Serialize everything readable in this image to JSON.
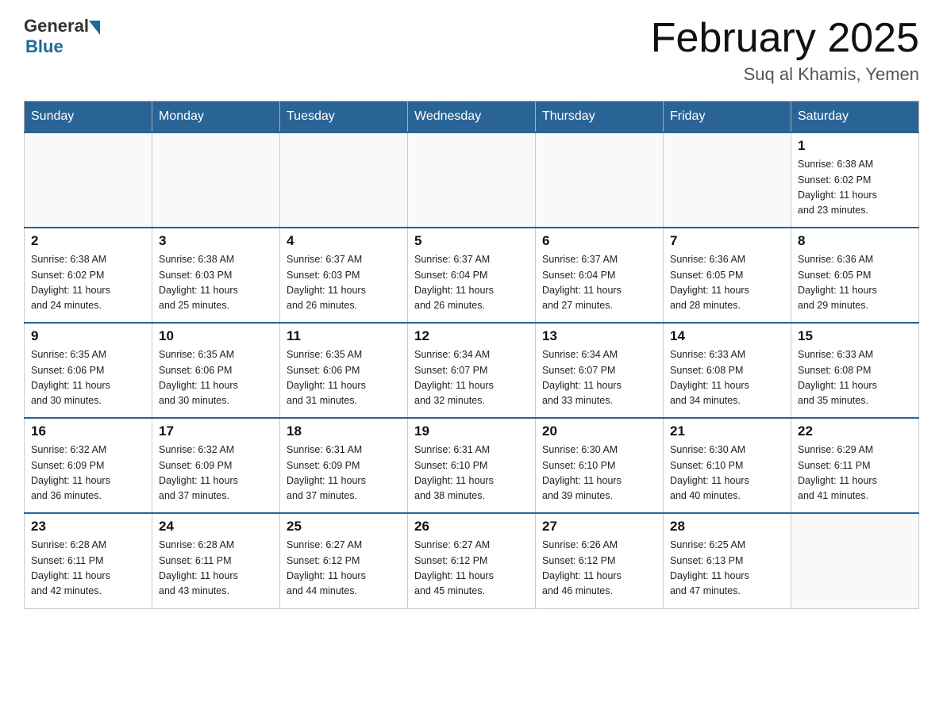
{
  "header": {
    "logo_general": "General",
    "logo_blue": "Blue",
    "month_title": "February 2025",
    "location": "Suq al Khamis, Yemen"
  },
  "days_of_week": [
    "Sunday",
    "Monday",
    "Tuesday",
    "Wednesday",
    "Thursday",
    "Friday",
    "Saturday"
  ],
  "weeks": [
    [
      {
        "day": "",
        "info": ""
      },
      {
        "day": "",
        "info": ""
      },
      {
        "day": "",
        "info": ""
      },
      {
        "day": "",
        "info": ""
      },
      {
        "day": "",
        "info": ""
      },
      {
        "day": "",
        "info": ""
      },
      {
        "day": "1",
        "info": "Sunrise: 6:38 AM\nSunset: 6:02 PM\nDaylight: 11 hours\nand 23 minutes."
      }
    ],
    [
      {
        "day": "2",
        "info": "Sunrise: 6:38 AM\nSunset: 6:02 PM\nDaylight: 11 hours\nand 24 minutes."
      },
      {
        "day": "3",
        "info": "Sunrise: 6:38 AM\nSunset: 6:03 PM\nDaylight: 11 hours\nand 25 minutes."
      },
      {
        "day": "4",
        "info": "Sunrise: 6:37 AM\nSunset: 6:03 PM\nDaylight: 11 hours\nand 26 minutes."
      },
      {
        "day": "5",
        "info": "Sunrise: 6:37 AM\nSunset: 6:04 PM\nDaylight: 11 hours\nand 26 minutes."
      },
      {
        "day": "6",
        "info": "Sunrise: 6:37 AM\nSunset: 6:04 PM\nDaylight: 11 hours\nand 27 minutes."
      },
      {
        "day": "7",
        "info": "Sunrise: 6:36 AM\nSunset: 6:05 PM\nDaylight: 11 hours\nand 28 minutes."
      },
      {
        "day": "8",
        "info": "Sunrise: 6:36 AM\nSunset: 6:05 PM\nDaylight: 11 hours\nand 29 minutes."
      }
    ],
    [
      {
        "day": "9",
        "info": "Sunrise: 6:35 AM\nSunset: 6:06 PM\nDaylight: 11 hours\nand 30 minutes."
      },
      {
        "day": "10",
        "info": "Sunrise: 6:35 AM\nSunset: 6:06 PM\nDaylight: 11 hours\nand 30 minutes."
      },
      {
        "day": "11",
        "info": "Sunrise: 6:35 AM\nSunset: 6:06 PM\nDaylight: 11 hours\nand 31 minutes."
      },
      {
        "day": "12",
        "info": "Sunrise: 6:34 AM\nSunset: 6:07 PM\nDaylight: 11 hours\nand 32 minutes."
      },
      {
        "day": "13",
        "info": "Sunrise: 6:34 AM\nSunset: 6:07 PM\nDaylight: 11 hours\nand 33 minutes."
      },
      {
        "day": "14",
        "info": "Sunrise: 6:33 AM\nSunset: 6:08 PM\nDaylight: 11 hours\nand 34 minutes."
      },
      {
        "day": "15",
        "info": "Sunrise: 6:33 AM\nSunset: 6:08 PM\nDaylight: 11 hours\nand 35 minutes."
      }
    ],
    [
      {
        "day": "16",
        "info": "Sunrise: 6:32 AM\nSunset: 6:09 PM\nDaylight: 11 hours\nand 36 minutes."
      },
      {
        "day": "17",
        "info": "Sunrise: 6:32 AM\nSunset: 6:09 PM\nDaylight: 11 hours\nand 37 minutes."
      },
      {
        "day": "18",
        "info": "Sunrise: 6:31 AM\nSunset: 6:09 PM\nDaylight: 11 hours\nand 37 minutes."
      },
      {
        "day": "19",
        "info": "Sunrise: 6:31 AM\nSunset: 6:10 PM\nDaylight: 11 hours\nand 38 minutes."
      },
      {
        "day": "20",
        "info": "Sunrise: 6:30 AM\nSunset: 6:10 PM\nDaylight: 11 hours\nand 39 minutes."
      },
      {
        "day": "21",
        "info": "Sunrise: 6:30 AM\nSunset: 6:10 PM\nDaylight: 11 hours\nand 40 minutes."
      },
      {
        "day": "22",
        "info": "Sunrise: 6:29 AM\nSunset: 6:11 PM\nDaylight: 11 hours\nand 41 minutes."
      }
    ],
    [
      {
        "day": "23",
        "info": "Sunrise: 6:28 AM\nSunset: 6:11 PM\nDaylight: 11 hours\nand 42 minutes."
      },
      {
        "day": "24",
        "info": "Sunrise: 6:28 AM\nSunset: 6:11 PM\nDaylight: 11 hours\nand 43 minutes."
      },
      {
        "day": "25",
        "info": "Sunrise: 6:27 AM\nSunset: 6:12 PM\nDaylight: 11 hours\nand 44 minutes."
      },
      {
        "day": "26",
        "info": "Sunrise: 6:27 AM\nSunset: 6:12 PM\nDaylight: 11 hours\nand 45 minutes."
      },
      {
        "day": "27",
        "info": "Sunrise: 6:26 AM\nSunset: 6:12 PM\nDaylight: 11 hours\nand 46 minutes."
      },
      {
        "day": "28",
        "info": "Sunrise: 6:25 AM\nSunset: 6:13 PM\nDaylight: 11 hours\nand 47 minutes."
      },
      {
        "day": "",
        "info": ""
      }
    ]
  ]
}
